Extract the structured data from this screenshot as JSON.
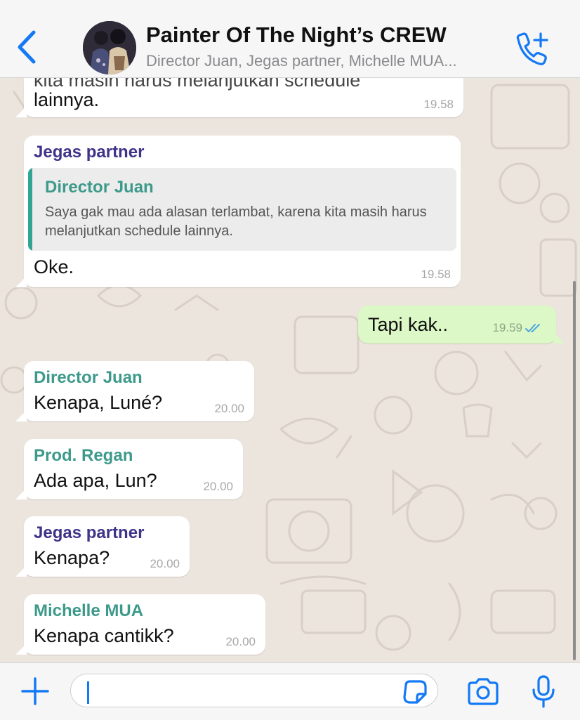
{
  "header": {
    "title": "Painter Of The Night’s CREW",
    "subtitle": "Director Juan, Jegas partner, Michelle MUA..."
  },
  "colors": {
    "accent": "#1479f5",
    "sender_teal": "#3d9a8b",
    "sender_purple": "#3e3389",
    "outgoing_bubble": "#dcf8c6",
    "read_ticks": "#4fa3e0"
  },
  "messages": [
    {
      "type": "in",
      "sender": "",
      "text": "lainnya.",
      "time": "19.58"
    },
    {
      "type": "in",
      "sender": "Jegas partner",
      "sender_color": "#3e3389",
      "quote": {
        "name": "Director Juan",
        "text": "Saya gak mau ada alasan terlambat, karena kita masih harus melanjutkan schedule lainnya."
      },
      "text": "Oke.",
      "time": "19.58"
    },
    {
      "type": "out",
      "text": "Tapi kak..",
      "time": "19.59",
      "status": "read"
    },
    {
      "type": "in",
      "sender": "Director Juan",
      "sender_color": "#3d9a8b",
      "text": "Kenapa, Luné?",
      "time": "20.00"
    },
    {
      "type": "in",
      "sender": "Prod. Regan",
      "sender_color": "#3d9a8b",
      "text": "Ada apa, Lun?",
      "time": "20.00"
    },
    {
      "type": "in",
      "sender": "Jegas partner",
      "sender_color": "#3e3389",
      "text": "Kenapa?",
      "time": "20.00"
    },
    {
      "type": "in",
      "sender": "Michelle MUA",
      "sender_color": "#3d9a8b",
      "text": "Kenapa cantikk?",
      "time": "20.00"
    }
  ],
  "input": {
    "value": "",
    "placeholder": ""
  },
  "icons": {
    "back": "chevron-left-icon",
    "call": "add-call-icon",
    "plus": "plus-icon",
    "sticker": "sticker-icon",
    "camera": "camera-icon",
    "mic": "microphone-icon"
  }
}
